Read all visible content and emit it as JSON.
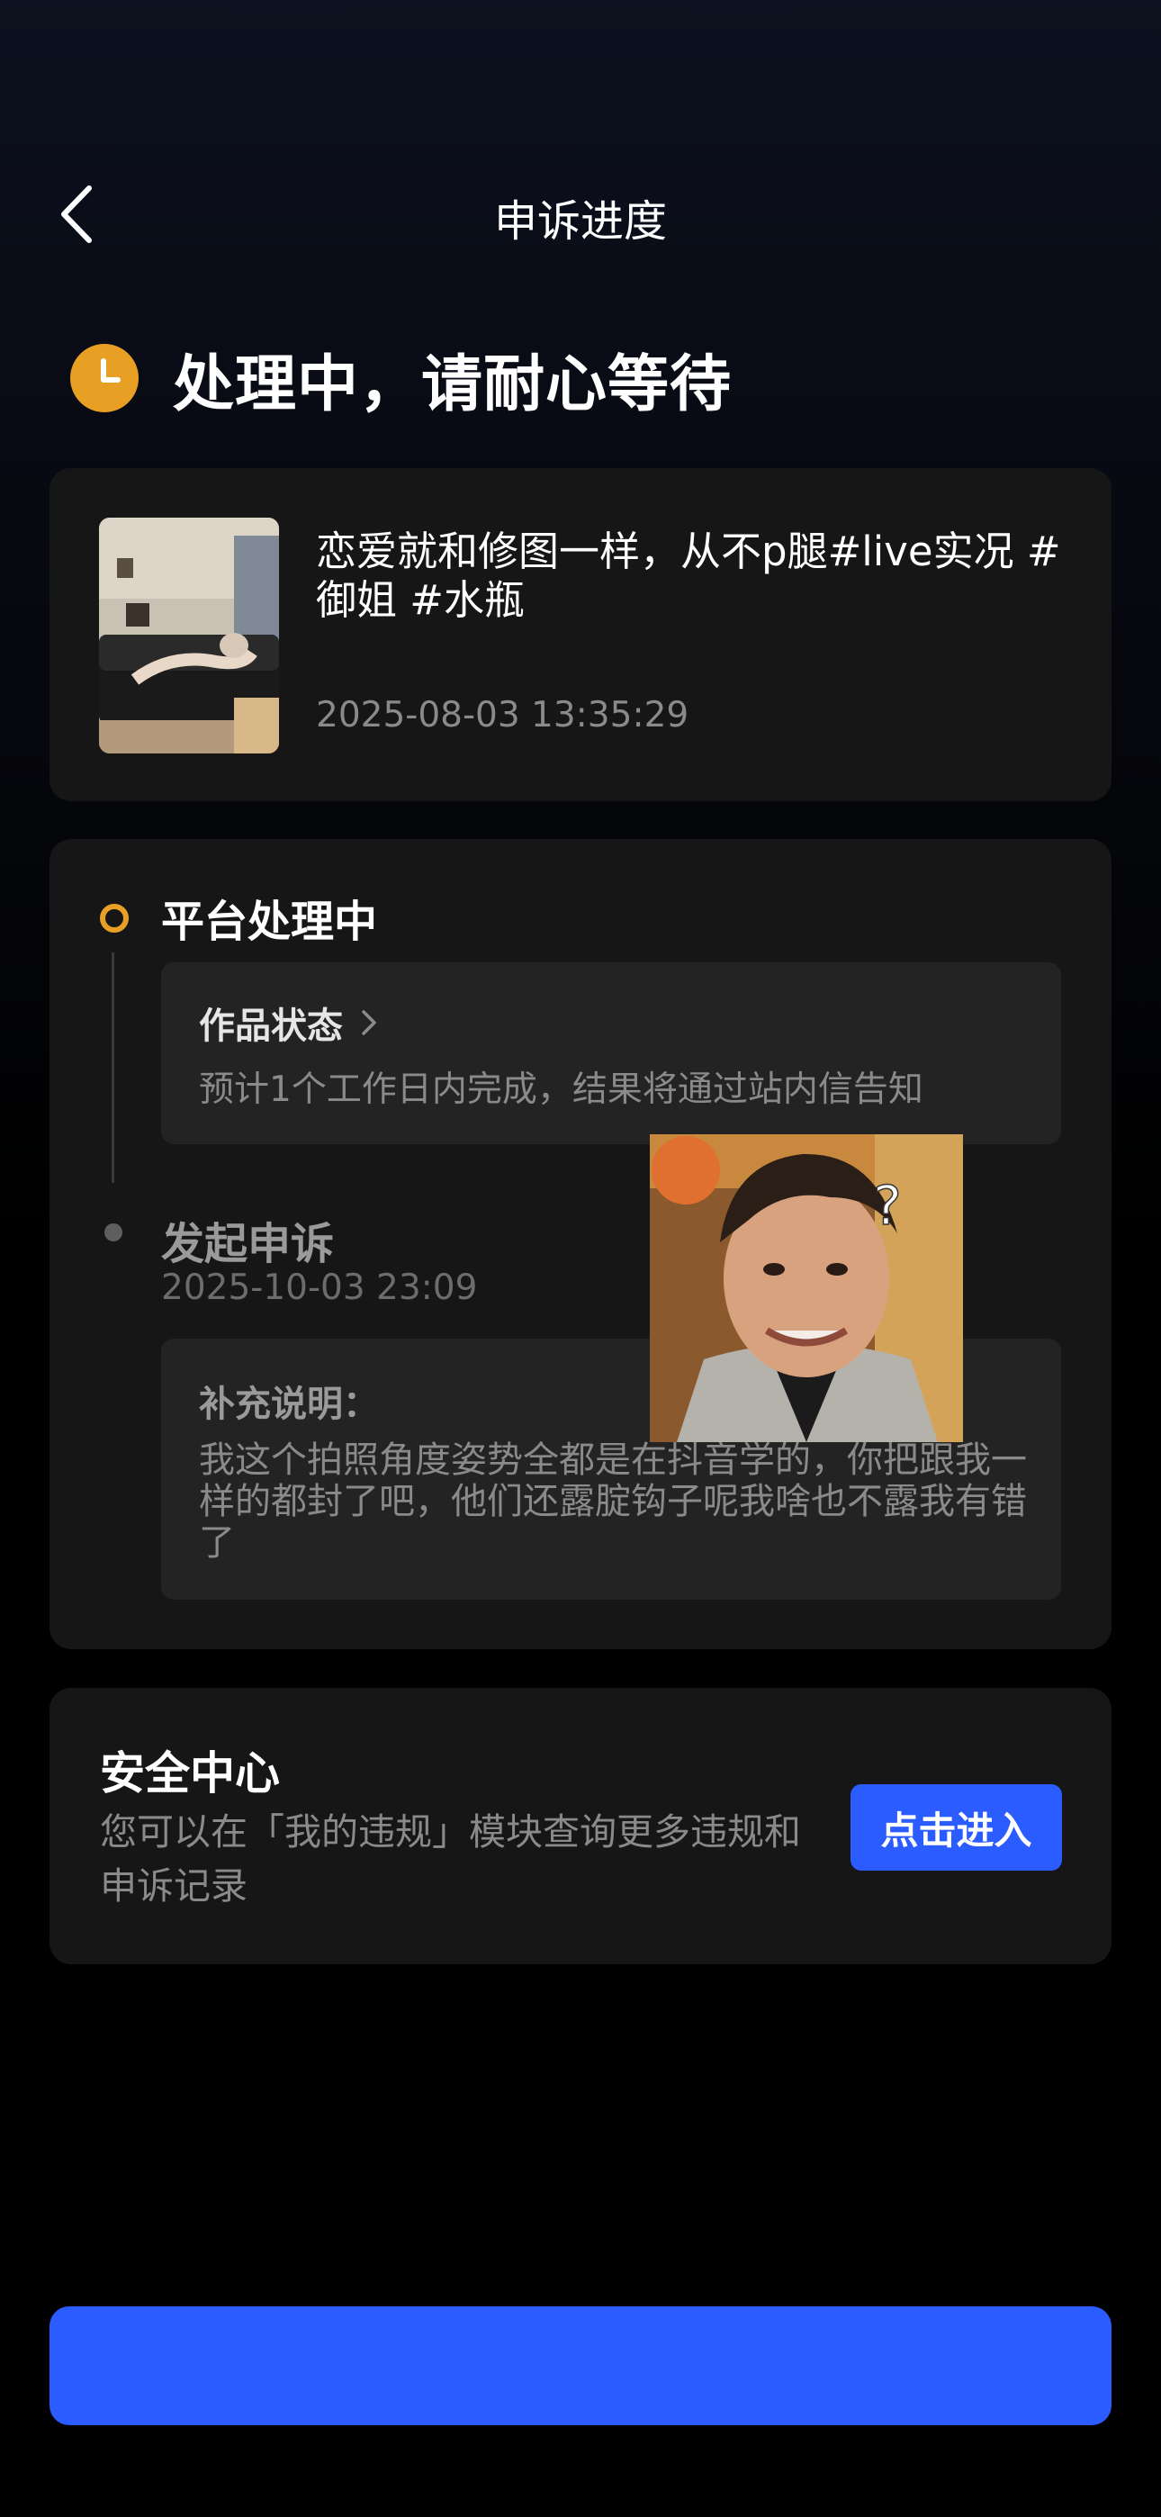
{
  "header": {
    "title": "申诉进度",
    "back_icon": "chevron-left-icon"
  },
  "status": {
    "text": "处理中，请耐心等待",
    "icon": "clock-icon",
    "color": "#E8A024"
  },
  "video": {
    "title": "恋爱就和修图一样，从不p腿#live实况 #御姐 #水瓶",
    "time": "2025-08-03 13:35:29"
  },
  "progress": {
    "step1": {
      "title": "平台处理中",
      "box_title": "作品状态",
      "box_desc": "预计1个工作日内完成，结果将通过站内信告知"
    },
    "step2": {
      "title": "发起申诉",
      "time": "2025-10-03 23:09",
      "note_label": "补充说明：",
      "note_text": "我这个拍照角度姿势全都是在抖音学的，你把跟我一样的都封了吧，他们还露腚钩子呢我啥也不露我有错了"
    }
  },
  "safety": {
    "title": "安全中心",
    "desc": "您可以在「我的违规」模块查询更多违规和申诉记录",
    "button_label": "点击进入"
  },
  "bottom_button": {
    "label": ""
  },
  "colors": {
    "accent_blue": "#2B5CFF",
    "status_orange": "#E8A024",
    "card_bg": "#161616"
  }
}
